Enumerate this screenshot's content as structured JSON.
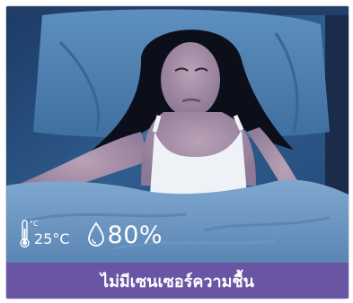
{
  "readout": {
    "temp_unit_small": "°C",
    "temperature": "25°C",
    "humidity": "80%",
    "thermometer_icon": "thermometer-icon",
    "droplet_icon": "droplet-icon"
  },
  "banner": {
    "text": "ไม่มีเซนเซอร์ความชื้น",
    "color": "#6a55a4"
  }
}
